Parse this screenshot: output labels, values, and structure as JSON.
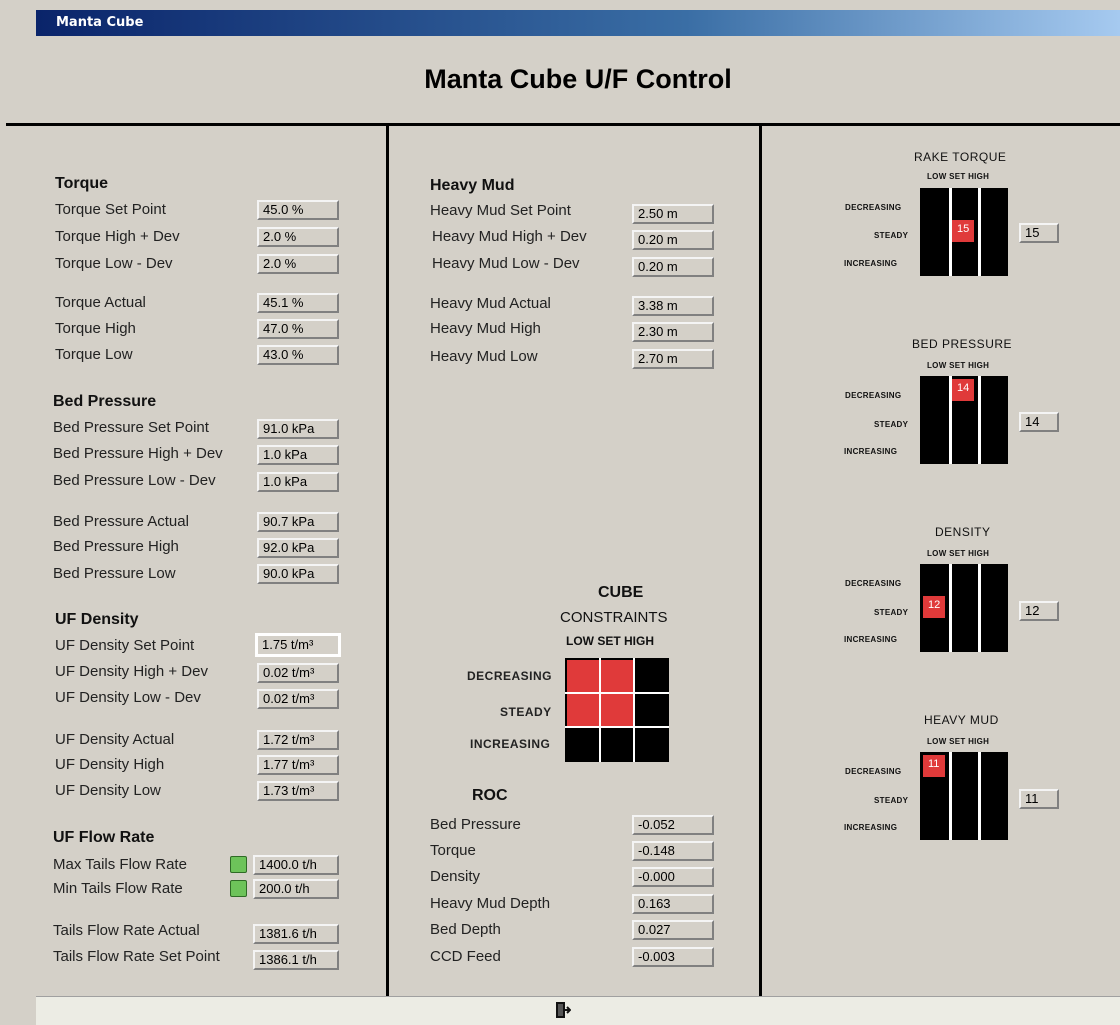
{
  "window": {
    "title": "Manta Cube"
  },
  "header": {
    "title": "Manta Cube U/F Control"
  },
  "torque": {
    "section": "Torque",
    "rows": [
      {
        "label": "Torque Set Point",
        "value": "45.0 %"
      },
      {
        "label": "Torque High + Dev",
        "value": "2.0 %"
      },
      {
        "label": "Torque Low - Dev",
        "value": "2.0 %"
      },
      {
        "label": "Torque Actual",
        "value": "45.1 %"
      },
      {
        "label": "Torque High",
        "value": "47.0 %"
      },
      {
        "label": "Torque Low",
        "value": "43.0 %"
      }
    ]
  },
  "bed": {
    "section": "Bed Pressure",
    "rows": [
      {
        "label": "Bed Pressure Set Point",
        "value": "91.0 kPa"
      },
      {
        "label": "Bed Pressure High + Dev",
        "value": "1.0 kPa"
      },
      {
        "label": "Bed Pressure Low - Dev",
        "value": "1.0 kPa"
      },
      {
        "label": "Bed Pressure Actual",
        "value": "90.7 kPa"
      },
      {
        "label": "Bed Pressure High",
        "value": "92.0 kPa"
      },
      {
        "label": "Bed Pressure Low",
        "value": "90.0 kPa"
      }
    ]
  },
  "density": {
    "section": "UF Density",
    "rows": [
      {
        "label": "UF Density Set Point",
        "value": "1.75 t/m³"
      },
      {
        "label": "UF Density High + Dev",
        "value": "0.02 t/m³"
      },
      {
        "label": "UF Density Low - Dev",
        "value": "0.02 t/m³"
      },
      {
        "label": "UF Density Actual",
        "value": "1.72 t/m³"
      },
      {
        "label": "UF Density High",
        "value": "1.77 t/m³"
      },
      {
        "label": "UF Density Low",
        "value": "1.73 t/m³"
      }
    ]
  },
  "flow": {
    "section": "UF Flow Rate",
    "rows": [
      {
        "label": "Max Tails Flow Rate",
        "value": "1400.0 t/h"
      },
      {
        "label": "Min Tails Flow Rate",
        "value": "200.0 t/h"
      },
      {
        "label": "Tails Flow Rate Actual",
        "value": "1381.6 t/h"
      },
      {
        "label": "Tails Flow Rate Set Point",
        "value": "1386.1 t/h"
      }
    ]
  },
  "mud": {
    "section": "Heavy Mud",
    "rows": [
      {
        "label": "Heavy Mud Set Point",
        "value": "2.50 m"
      },
      {
        "label": "Heavy Mud High + Dev",
        "value": "0.20 m"
      },
      {
        "label": "Heavy Mud Low - Dev",
        "value": "0.20 m"
      },
      {
        "label": "Heavy Mud Actual",
        "value": "3.38 m"
      },
      {
        "label": "Heavy Mud High",
        "value": "2.30 m"
      },
      {
        "label": "Heavy Mud Low",
        "value": "2.70 m"
      }
    ]
  },
  "cube": {
    "title1": "CUBE",
    "title2": "CONSTRAINTS",
    "cols": "LOW SET HIGH",
    "rows": [
      "DECREASING",
      "STEADY",
      "INCREASING"
    ]
  },
  "roc": {
    "section": "ROC",
    "rows": [
      {
        "label": "Bed Pressure",
        "value": "-0.052"
      },
      {
        "label": "Torque",
        "value": "-0.148"
      },
      {
        "label": "Density",
        "value": "-0.000"
      },
      {
        "label": "Heavy Mud Depth",
        "value": "0.163"
      },
      {
        "label": "Bed Depth",
        "value": "0.027"
      },
      {
        "label": "CCD Feed",
        "value": "-0.003"
      }
    ]
  },
  "grids": [
    {
      "title": "RAKE TORQUE",
      "cols": "LOW SET HIGH",
      "rows": [
        "DECREASING",
        "STEADY",
        "INCREASING"
      ],
      "active": "15",
      "value": "15"
    },
    {
      "title": "BED PRESSURE",
      "cols": "LOW SET HIGH",
      "rows": [
        "DECREASING",
        "STEADY",
        "INCREASING"
      ],
      "active": "14",
      "value": "14"
    },
    {
      "title": "DENSITY",
      "cols": "LOW SET HIGH",
      "rows": [
        "DECREASING",
        "STEADY",
        "INCREASING"
      ],
      "active": "12",
      "value": "12"
    },
    {
      "title": "HEAVY MUD",
      "cols": "LOW SET HIGH",
      "rows": [
        "DECREASING",
        "STEADY",
        "INCREASING"
      ],
      "active": "11",
      "value": "11"
    }
  ],
  "colors": {
    "active_cell": "#e03a3a",
    "indicator_ok": "#6dc35a",
    "title_bar": "#0a246a"
  },
  "icons": {
    "exit": "exit-door-icon"
  }
}
